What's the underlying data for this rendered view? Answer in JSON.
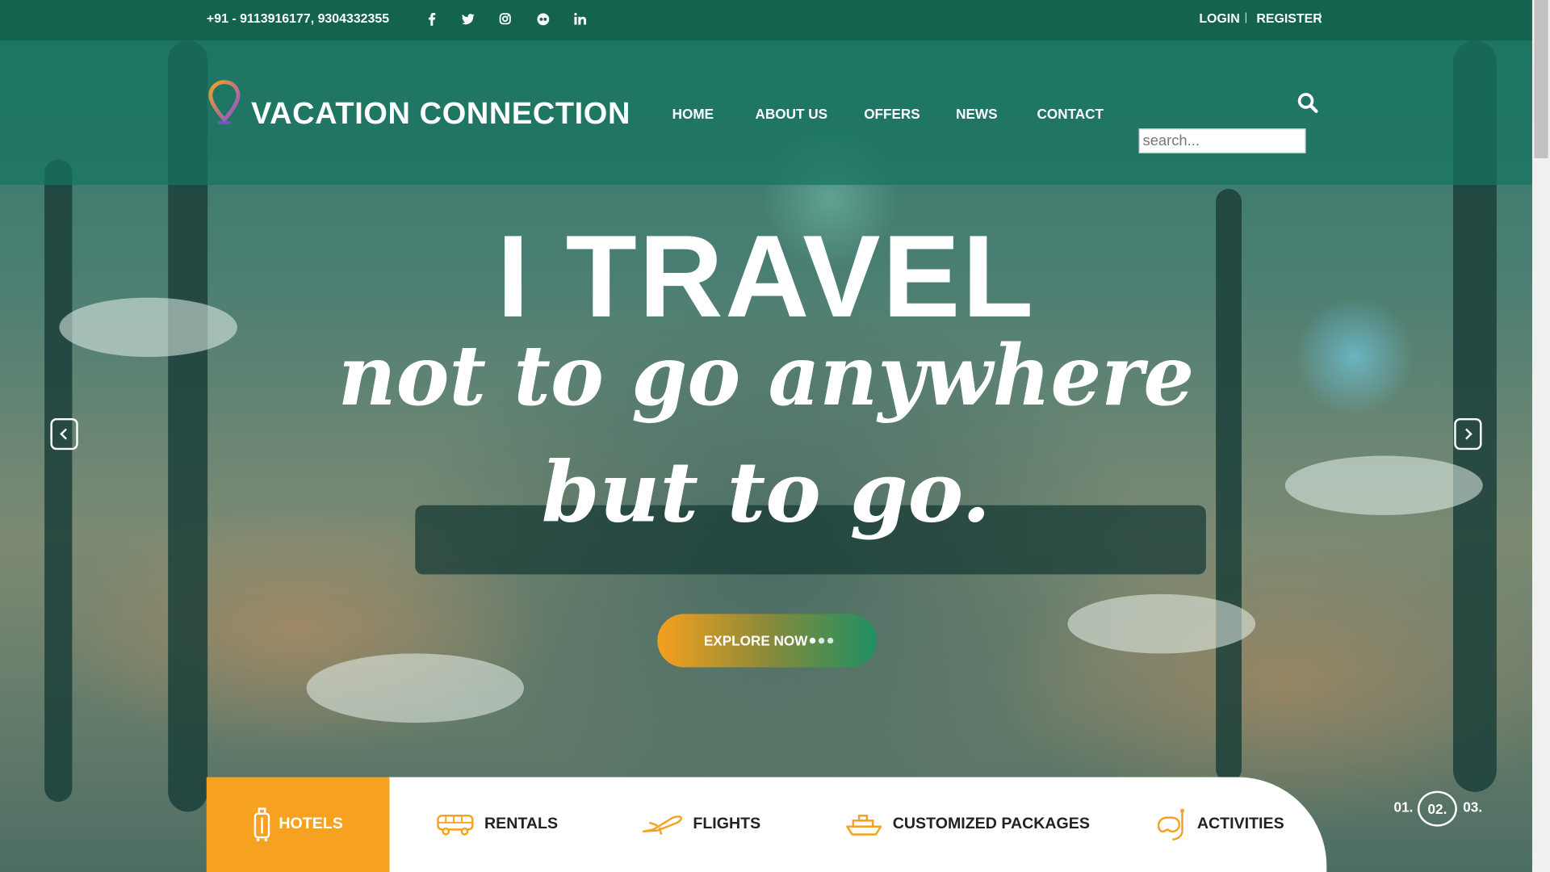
{
  "topbar": {
    "phone": "+91 - 9113916177, 9304332355",
    "social": [
      "facebook-icon",
      "twitter-icon",
      "instagram-icon",
      "tripadvisor-icon",
      "linkedin-icon"
    ],
    "login": "LOGIN",
    "register": "REGISTER"
  },
  "brand": {
    "name": "VACATION CONNECTION"
  },
  "nav": {
    "items": [
      "HOME",
      "ABOUT US",
      "OFFERS",
      "NEWS",
      "CONTACT"
    ]
  },
  "search": {
    "placeholder": "search..."
  },
  "hero": {
    "line1": "I TRAVEL",
    "line2": "not to go anywhere",
    "line3": "but to go.",
    "cta": "EXPLORE NOW"
  },
  "tabs": [
    "HOTELS",
    "RENTALS",
    "FLIGHTS",
    "CUSTOMIZED PACKAGES",
    "ACTIVITIES"
  ],
  "pager": {
    "items": [
      "01.",
      "02.",
      "03."
    ],
    "active": "02."
  },
  "colors": {
    "header": "#14634f",
    "accent": "#f6a11f",
    "white": "#ffffff"
  }
}
